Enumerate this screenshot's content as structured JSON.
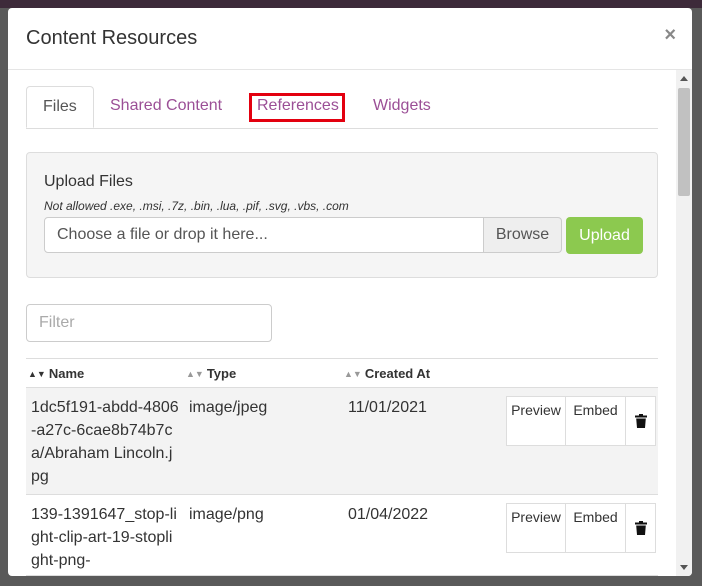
{
  "modal": {
    "title": "Content Resources"
  },
  "tabs": [
    {
      "label": "Files"
    },
    {
      "label": "Shared Content"
    },
    {
      "label": "References"
    },
    {
      "label": "Widgets"
    }
  ],
  "upload": {
    "title": "Upload Files",
    "note": "Not allowed .exe, .msi, .7z, .bin, .lua, .pif, .svg, .vbs, .com",
    "placeholder": "Choose a file or drop it here...",
    "browse_label": "Browse",
    "upload_label": "Upload"
  },
  "filter": {
    "placeholder": "Filter"
  },
  "table": {
    "columns": [
      "Name",
      "Type",
      "Created At"
    ],
    "rows": [
      {
        "name": "1dc5f191-abdd-4806-a27c-6cae8b74b7ca/Abraham Lincoln.jpg",
        "type": "image/jpeg",
        "created": "11/01/2021",
        "preview": "Preview",
        "embed": "Embed"
      },
      {
        "name": "139-1391647_stop-light-clip-art-19-stoplight-png-",
        "type": "image/png",
        "created": "01/04/2022",
        "preview": "Preview",
        "embed": "Embed"
      }
    ]
  },
  "colors": {
    "accent": "#9b4f96",
    "upload": "#8cc94f",
    "highlight": "#e3000f"
  }
}
